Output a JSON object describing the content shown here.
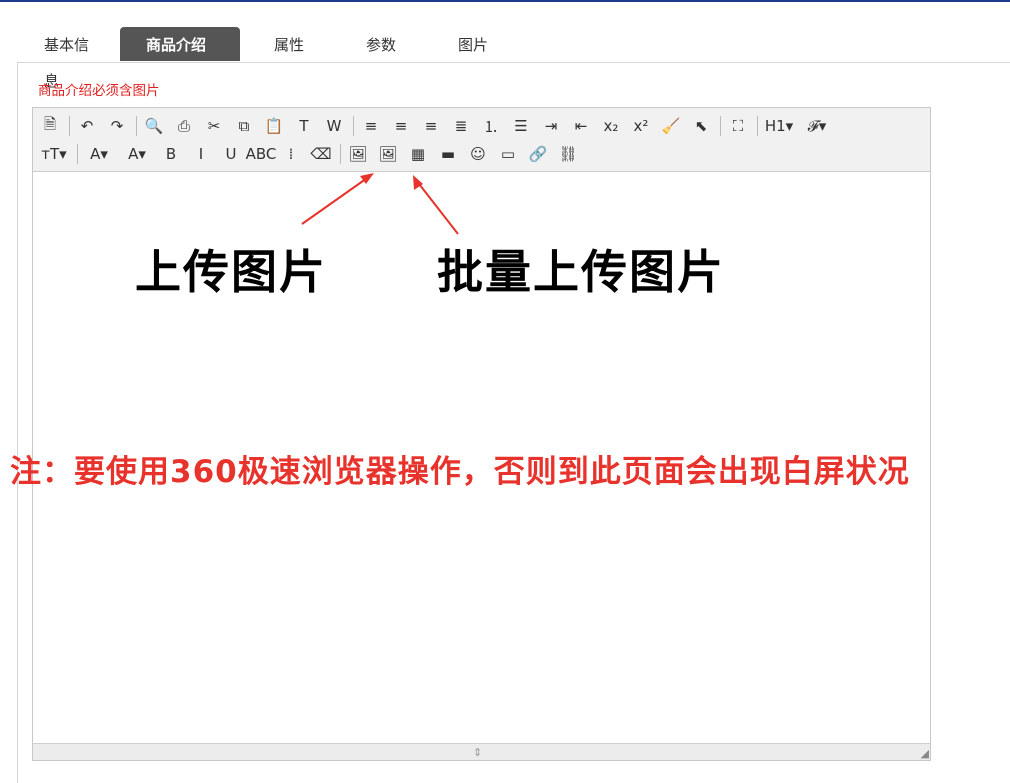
{
  "tabs": [
    {
      "label": "基本信息"
    },
    {
      "label": "商品介绍",
      "active": true
    },
    {
      "label": "属性"
    },
    {
      "label": "参数"
    },
    {
      "label": "图片"
    }
  ],
  "hint": "商品介绍必须含图片",
  "toolbar": {
    "row1": [
      {
        "icon": "source-icon",
        "glyph": "🗎"
      },
      {
        "sep": true
      },
      {
        "icon": "undo-icon",
        "glyph": "↶"
      },
      {
        "icon": "redo-icon",
        "glyph": "↷"
      },
      {
        "sep": true
      },
      {
        "icon": "preview-icon",
        "glyph": "🔍"
      },
      {
        "icon": "print-icon",
        "glyph": "⎙"
      },
      {
        "icon": "cut-icon",
        "glyph": "✂"
      },
      {
        "icon": "copy-icon",
        "glyph": "⧉"
      },
      {
        "icon": "paste-icon",
        "glyph": "📋"
      },
      {
        "icon": "paste-text-icon",
        "glyph": "T"
      },
      {
        "icon": "paste-word-icon",
        "glyph": "W"
      },
      {
        "sep": true
      },
      {
        "icon": "align-left-icon",
        "glyph": "≡"
      },
      {
        "icon": "align-center-icon",
        "glyph": "≡"
      },
      {
        "icon": "align-right-icon",
        "glyph": "≡"
      },
      {
        "icon": "align-justify-icon",
        "glyph": "≣"
      },
      {
        "icon": "ordered-list-icon",
        "glyph": "⒈"
      },
      {
        "icon": "unordered-list-icon",
        "glyph": "☰"
      },
      {
        "icon": "indent-icon",
        "glyph": "⇥"
      },
      {
        "icon": "outdent-icon",
        "glyph": "⇤"
      },
      {
        "icon": "subscript-icon",
        "glyph": "x₂"
      },
      {
        "icon": "superscript-icon",
        "glyph": "x²"
      },
      {
        "icon": "clear-format-icon",
        "glyph": "🧹"
      },
      {
        "icon": "select-all-icon",
        "glyph": "⬉"
      },
      {
        "sep": true
      },
      {
        "icon": "fullscreen-icon",
        "glyph": "⛶"
      },
      {
        "sep": true
      },
      {
        "icon": "heading-icon",
        "glyph": "H1▾",
        "wide": true
      },
      {
        "icon": "font-family-icon",
        "glyph": "𝓕▾",
        "wide": true
      }
    ],
    "row2": [
      {
        "icon": "font-size-icon",
        "glyph": "ᴛT▾",
        "wide": true
      },
      {
        "sep": true
      },
      {
        "icon": "font-color-icon",
        "glyph": "A▾",
        "wide": true
      },
      {
        "icon": "highlight-color-icon",
        "glyph": "A▾",
        "wide": true
      },
      {
        "icon": "bold-icon",
        "glyph": "B"
      },
      {
        "icon": "italic-icon",
        "glyph": "I"
      },
      {
        "icon": "underline-icon",
        "glyph": "U"
      },
      {
        "icon": "strikethrough-icon",
        "glyph": "ABC"
      },
      {
        "icon": "line-height-icon",
        "glyph": "⁞"
      },
      {
        "icon": "eraser-icon",
        "glyph": "⌫"
      },
      {
        "sep": true
      },
      {
        "icon": "upload-image-icon",
        "glyph": "🖼"
      },
      {
        "icon": "batch-upload-image-icon",
        "glyph": "🖼"
      },
      {
        "icon": "table-icon",
        "glyph": "▦"
      },
      {
        "icon": "flash-icon",
        "glyph": "▬"
      },
      {
        "icon": "emoticon-icon",
        "glyph": "☺"
      },
      {
        "icon": "page-break-icon",
        "glyph": "▭"
      },
      {
        "icon": "link-icon",
        "glyph": "🔗"
      },
      {
        "icon": "unlink-icon",
        "glyph": "⛓"
      }
    ]
  },
  "annotations": {
    "upload": "上传图片",
    "batch_upload": "批量上传图片",
    "note": "注：要使用360极速浏览器操作，否则到此页面会出现白屏状况"
  },
  "colors": {
    "accent_bar": "#1f3c8c",
    "active_tab_bg": "#555555",
    "hint": "#e02020",
    "note": "#e8322c",
    "arrow": "#e8322c"
  }
}
